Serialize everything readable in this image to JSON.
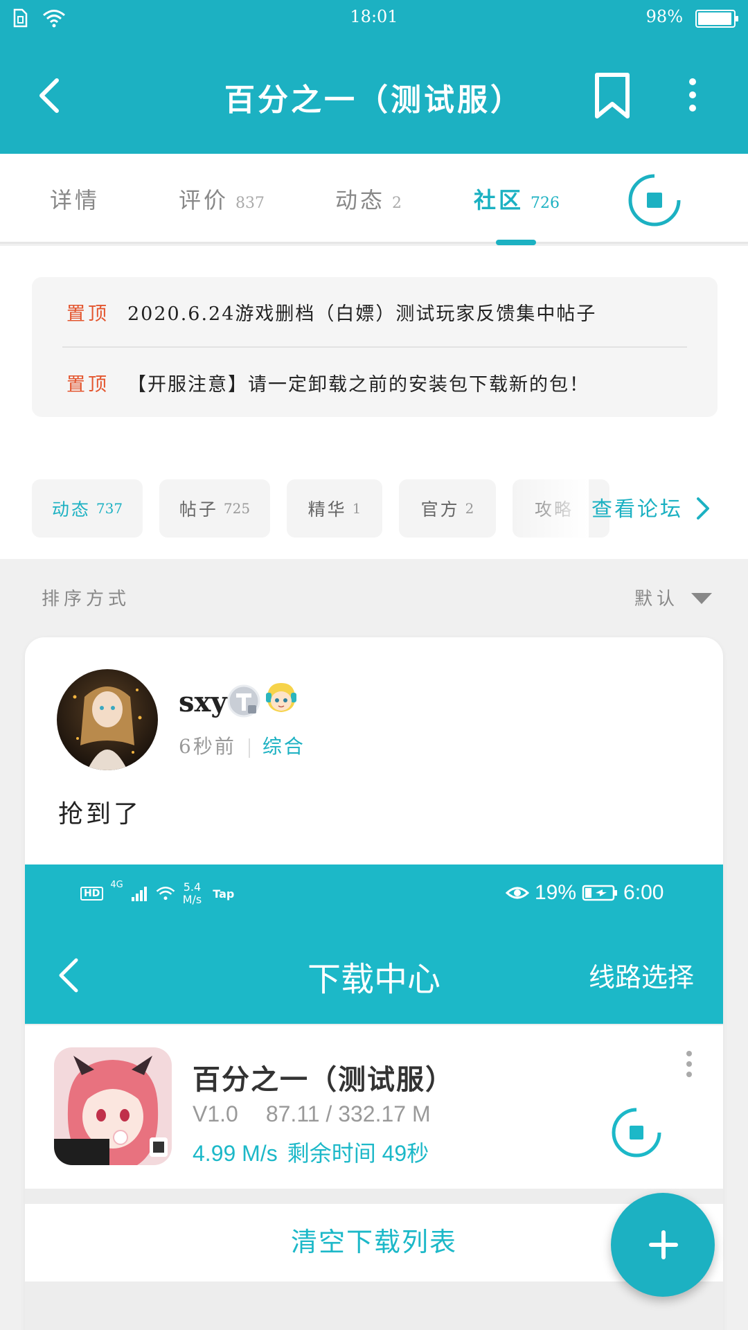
{
  "status_bar": {
    "time": "18:01",
    "battery": "98%"
  },
  "header": {
    "title": "百分之一（测试服）"
  },
  "tabs": [
    {
      "label": "详情",
      "count": ""
    },
    {
      "label": "评价",
      "count": "837"
    },
    {
      "label": "动态",
      "count": "2"
    },
    {
      "label": "社区",
      "count": "726"
    }
  ],
  "active_tab": "社区",
  "pinned": [
    {
      "tag": "置顶",
      "text": "2020.6.24游戏删档（白嫖）测试玩家反馈集中帖子"
    },
    {
      "tag": "置顶",
      "text": "【开服注意】请一定卸载之前的安装包下载新的包！"
    }
  ],
  "chips": [
    {
      "label": "动态",
      "count": "737"
    },
    {
      "label": "帖子",
      "count": "725"
    },
    {
      "label": "精华",
      "count": "1"
    },
    {
      "label": "官方",
      "count": "2"
    },
    {
      "label": "攻略",
      "count": ""
    }
  ],
  "forum_link": "查看论坛",
  "sort": {
    "label": "排序方式",
    "value": "默认"
  },
  "post": {
    "username": "sxy",
    "time": "6秒前",
    "category": "综合",
    "text": "抢到了",
    "screenshot": {
      "status_left": {
        "hd": "HD",
        "net": "4G",
        "speed_value": "5.4",
        "speed_unit": "M/s",
        "app": "Tap"
      },
      "status_right": {
        "eye_pct": "19%",
        "time": "6:00"
      },
      "title": "下载中心",
      "route": "线路选择",
      "item": {
        "name": "百分之一（测试服）",
        "version": "V1.0",
        "size": "87.11 / 332.17 M",
        "speed": "4.99 M/s",
        "remaining": "剩余时间 49秒"
      },
      "clear": "清空下载列表"
    }
  },
  "colors": {
    "accent": "#1cb1c2",
    "pin": "#e3552e"
  }
}
